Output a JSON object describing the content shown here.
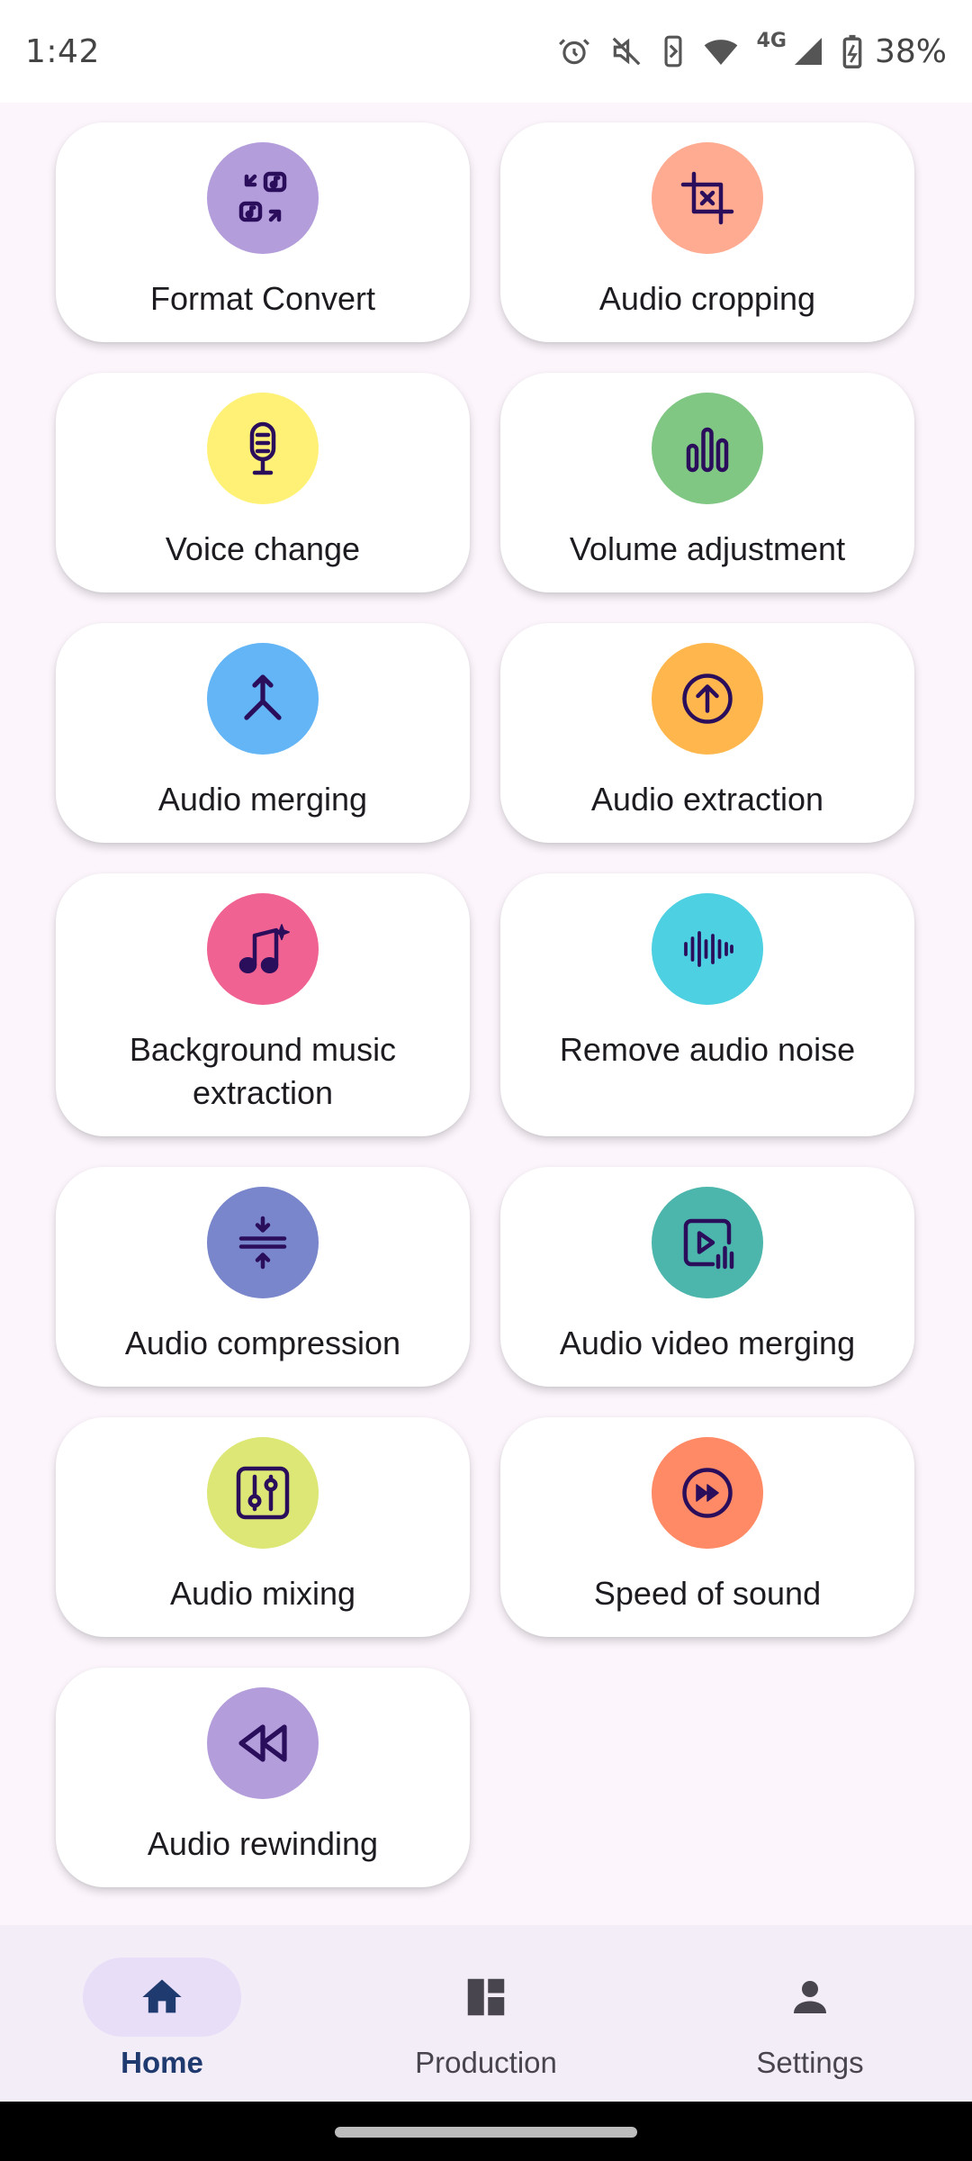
{
  "status_bar": {
    "time": "1:42",
    "network": "4G",
    "battery": "38%"
  },
  "cards": [
    {
      "label": "Format Convert",
      "icon": "format-convert-icon",
      "color": "#b39ddb"
    },
    {
      "label": "Audio cropping",
      "icon": "crop-icon",
      "color": "#ffab91"
    },
    {
      "label": "Voice change",
      "icon": "microphone-icon",
      "color": "#fff176"
    },
    {
      "label": "Volume adjustment",
      "icon": "volume-bars-icon",
      "color": "#81c784"
    },
    {
      "label": "Audio merging",
      "icon": "merge-icon",
      "color": "#64b5f6"
    },
    {
      "label": "Audio extraction",
      "icon": "upload-circle-icon",
      "color": "#ffb74d"
    },
    {
      "label": "Background music extraction",
      "icon": "music-note-sparkle-icon",
      "color": "#f06292"
    },
    {
      "label": "Remove audio noise",
      "icon": "waveform-icon",
      "color": "#4dd0e1"
    },
    {
      "label": "Audio compression",
      "icon": "compress-icon",
      "color": "#7986cb"
    },
    {
      "label": "Audio video merging",
      "icon": "video-audio-icon",
      "color": "#4db6ac"
    },
    {
      "label": "Audio mixing",
      "icon": "mixer-sliders-icon",
      "color": "#dce775"
    },
    {
      "label": "Speed of sound",
      "icon": "fast-forward-circle-icon",
      "color": "#ff8a65"
    },
    {
      "label": "Audio rewinding",
      "icon": "rewind-icon",
      "color": "#b39ddb"
    }
  ],
  "bottom_nav": {
    "items": [
      {
        "label": "Home",
        "icon": "home-icon",
        "active": true
      },
      {
        "label": "Production",
        "icon": "dashboard-icon",
        "active": false
      },
      {
        "label": "Settings",
        "icon": "person-icon",
        "active": false
      }
    ]
  },
  "colors": {
    "icon_stroke": "#2a0e5c",
    "active_nav": "#1f3a6e",
    "active_pill": "#e8def8"
  }
}
